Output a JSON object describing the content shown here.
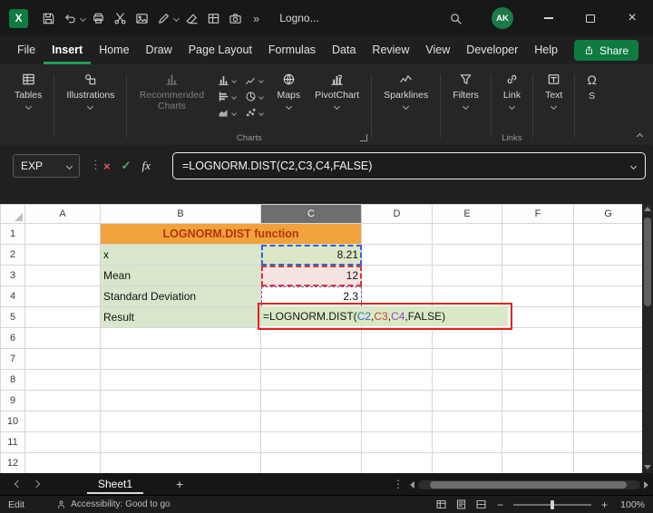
{
  "titlebar": {
    "title": "Logno...",
    "avatar_initials": "AK",
    "more_glyph": "»"
  },
  "menubar": {
    "items": [
      "File",
      "Insert",
      "Home",
      "Draw",
      "Page Layout",
      "Formulas",
      "Data",
      "Review",
      "View",
      "Developer",
      "Help"
    ],
    "active_item": "Insert",
    "share_label": "Share"
  },
  "ribbon": {
    "tables_label": "Tables",
    "illustrations_label": "Illustrations",
    "recommended_charts_label": "Recommended Charts",
    "maps_label": "Maps",
    "pivotchart_label": "PivotChart",
    "sparklines_label": "Sparklines",
    "filters_label": "Filters",
    "link_label": "Link",
    "text_label": "Text",
    "symbols_label": "S",
    "charts_group_label": "Charts",
    "links_group_label": "Links"
  },
  "formula_bar": {
    "name_box_value": "EXP",
    "fx_label": "fx",
    "formula": "=LOGNORM.DIST(C2,C3,C4,FALSE)"
  },
  "grid": {
    "column_headers": [
      "A",
      "B",
      "C",
      "D",
      "E",
      "F",
      "G"
    ],
    "selected_column": "C",
    "row_headers": [
      "1",
      "2",
      "3",
      "4",
      "5",
      "6",
      "7",
      "8",
      "9",
      "10",
      "11",
      "12"
    ],
    "cells": {
      "title": "LOGNORM.DIST function",
      "rows": [
        {
          "label": "x",
          "value": "8.21"
        },
        {
          "label": "Mean",
          "value": "12"
        },
        {
          "label": "Standard Deviation",
          "value": "2.3"
        },
        {
          "label": "Result",
          "value": ""
        }
      ]
    },
    "edit_cell": {
      "parts": [
        {
          "text": "=LOGNORM.DIST(",
          "style": "color:#161616"
        },
        {
          "text": "C2",
          "style": "color:#2e66d0"
        },
        {
          "text": ",",
          "style": "color:#161616"
        },
        {
          "text": "C3",
          "style": "color:#d13a30"
        },
        {
          "text": ",",
          "style": "color:#161616"
        },
        {
          "text": "C4",
          "style": "color:#9649c8"
        },
        {
          "text": ",FALSE)",
          "style": "color:#161616"
        }
      ]
    }
  },
  "sheet_bar": {
    "tab_label": "Sheet1",
    "add_glyph": "+",
    "kebab_glyph": "⋮"
  },
  "status_bar": {
    "mode": "Edit",
    "accessibility": "Accessibility: Good to go",
    "zoom_out_glyph": "−",
    "zoom_in_glyph": "+",
    "zoom_label": "100%"
  },
  "icons_glyphs": {
    "cancel": "×",
    "confirm": "✓",
    "kebab": "⋮",
    "close": "×"
  },
  "colors": {
    "accent_green": "#1f9e54",
    "share_green": "#0f7b41",
    "title_fill": "#f2a23c",
    "title_text": "#b5330f",
    "label_fill": "#d8e7cb",
    "edit_fill": "#d9e8c6",
    "c2_fill": "#dbe7c6",
    "c3_fill": "#f6e4e2",
    "highlight_red": "#e0251b",
    "ref_blue": "#2e66d0",
    "ref_red": "#d13a30",
    "ref_purple": "#9649c8"
  }
}
